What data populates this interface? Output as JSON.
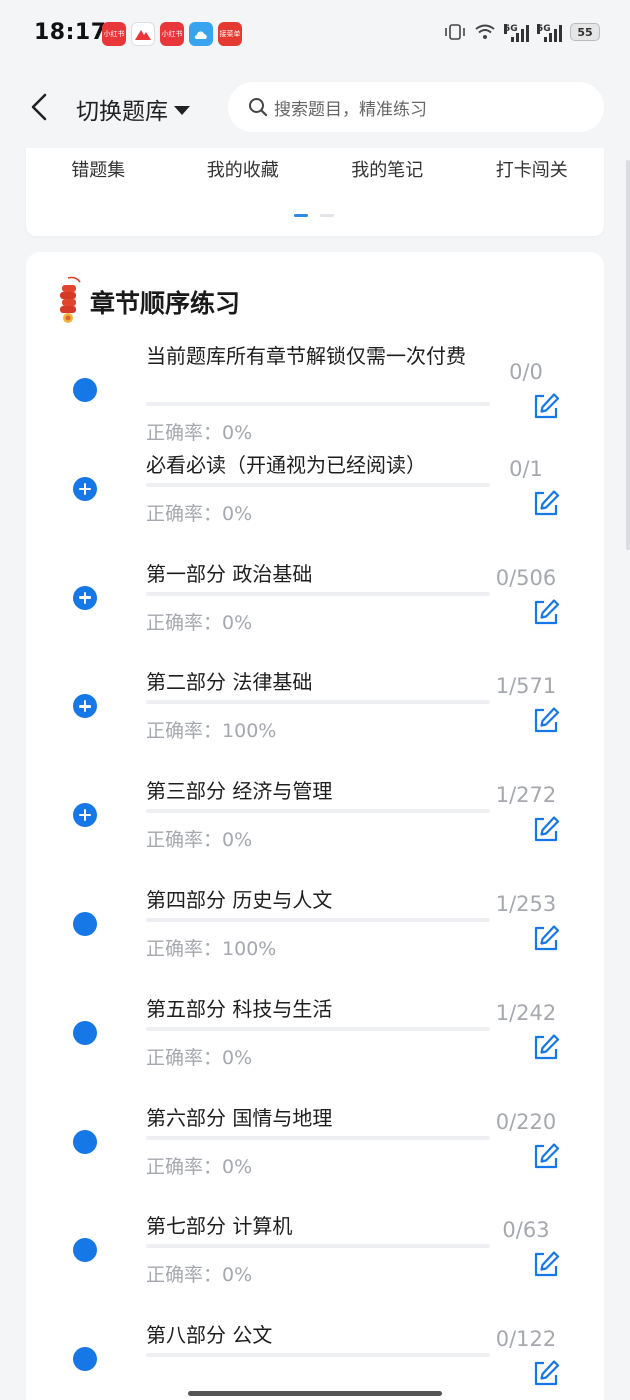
{
  "status_bar": {
    "time": "18:17",
    "apps": [
      "小红书",
      "",
      "小红书",
      "",
      "接菜单"
    ],
    "network_1": "5G",
    "network_2": "5G",
    "battery": "55"
  },
  "header": {
    "bank_switch_label": "切换题库",
    "search_placeholder": "搜索题目，精准练习"
  },
  "quick_links": [
    {
      "label": "错题集"
    },
    {
      "label": "我的收藏"
    },
    {
      "label": "我的笔记"
    },
    {
      "label": "打卡闯关"
    }
  ],
  "pager": {
    "pages": 2,
    "active": 1
  },
  "chapter_section": {
    "title": "章节顺序练习",
    "accuracy_prefix": "正确率：",
    "items": [
      {
        "title": "当前题库所有章节解锁仅需一次付费",
        "accuracy": "0%",
        "count": "0/0",
        "icon": "filled-dot"
      },
      {
        "title": "必看必读（开通视为已经阅读）",
        "accuracy": "0%",
        "count": "0/1",
        "icon": "plus-circle"
      },
      {
        "title": "第一部分 政治基础",
        "accuracy": "0%",
        "count": "0/506",
        "icon": "plus-circle"
      },
      {
        "title": "第二部分 法律基础",
        "accuracy": "100%",
        "count": "1/571",
        "icon": "plus-circle"
      },
      {
        "title": "第三部分 经济与管理",
        "accuracy": "0%",
        "count": "1/272",
        "icon": "plus-circle"
      },
      {
        "title": "第四部分 历史与人文",
        "accuracy": "100%",
        "count": "1/253",
        "icon": "filled-dot"
      },
      {
        "title": "第五部分 科技与生活",
        "accuracy": "0%",
        "count": "1/242",
        "icon": "filled-dot"
      },
      {
        "title": "第六部分 国情与地理",
        "accuracy": "0%",
        "count": "0/220",
        "icon": "filled-dot"
      },
      {
        "title": "第七部分 计算机",
        "accuracy": "0%",
        "count": "0/63",
        "icon": "filled-dot"
      },
      {
        "title": "第八部分 公文",
        "accuracy": "",
        "count": "0/122",
        "icon": "filled-dot"
      }
    ]
  },
  "colors": {
    "accent": "#1677e6",
    "text_muted": "#a5a8ae",
    "background": "#f4f5f7"
  }
}
